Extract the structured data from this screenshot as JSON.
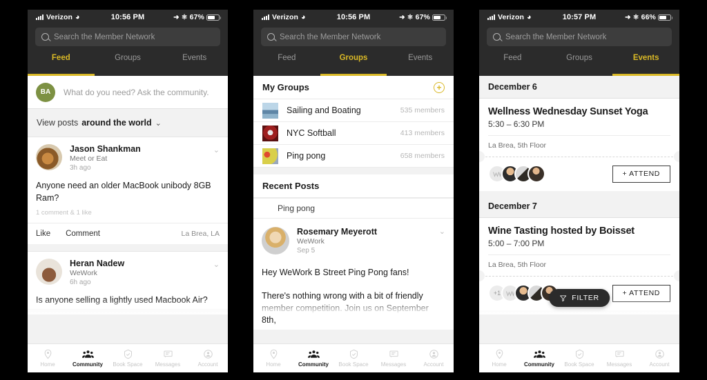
{
  "accent": "#d9b826",
  "panels": [
    {
      "id": "feed",
      "statusbar": {
        "carrier": "Verizon",
        "time": "10:56 PM",
        "battery": "67%"
      },
      "search": {
        "placeholder": "Search the Member Network"
      },
      "tabs": [
        {
          "label": "Feed",
          "active": true
        },
        {
          "label": "Groups",
          "active": false
        },
        {
          "label": "Events",
          "active": false
        }
      ],
      "composer": {
        "initials": "BA",
        "placeholder": "What do you need? Ask the community."
      },
      "filter_row": {
        "prefix": "View posts",
        "value": "around the world",
        "chevron": "∨"
      },
      "posts": [
        {
          "name": "Jason Shankman",
          "org": "Meet or Eat",
          "time": "3h ago",
          "text": "Anyone need an older MacBook unibody 8GB Ram?",
          "meta": "1 comment & 1 like",
          "like_label": "Like",
          "comment_label": "Comment",
          "location": "La Brea, LA"
        },
        {
          "name": "Heran Nadew",
          "org": "WeWork",
          "time": "6h ago",
          "text": "Is anyone selling a lightly used Macbook Air?"
        }
      ]
    },
    {
      "id": "groups",
      "statusbar": {
        "carrier": "Verizon",
        "time": "10:56 PM",
        "battery": "67%"
      },
      "search": {
        "placeholder": "Search the Member Network"
      },
      "tabs": [
        {
          "label": "Feed",
          "active": false
        },
        {
          "label": "Groups",
          "active": true
        },
        {
          "label": "Events",
          "active": false
        }
      ],
      "my_groups": {
        "title": "My Groups",
        "add_label": "+",
        "items": [
          {
            "name": "Sailing and Boating",
            "members": "535 members"
          },
          {
            "name": "NYC Softball",
            "members": "413 members"
          },
          {
            "name": "Ping pong",
            "members": "658 members"
          }
        ]
      },
      "recent_posts": {
        "title": "Recent Posts",
        "group_tag": "Ping pong",
        "post": {
          "name": "Rosemary Meyerott",
          "org": "WeWork",
          "time": "Sep 5",
          "line1": "Hey WeWork B Street Ping Pong fans!",
          "line2": "There's nothing wrong with a bit of friendly member competition. Join us on September 8th,"
        }
      }
    },
    {
      "id": "events",
      "statusbar": {
        "carrier": "Verizon",
        "time": "10:57 PM",
        "battery": "66%"
      },
      "search": {
        "placeholder": "Search the Member Network"
      },
      "tabs": [
        {
          "label": "Feed",
          "active": false
        },
        {
          "label": "Groups",
          "active": false
        },
        {
          "label": "Events",
          "active": true
        }
      ],
      "filter_button": {
        "label": "FILTER"
      },
      "days": [
        {
          "date": "December 6",
          "event": {
            "title": "Wellness Wednesday Sunset Yoga",
            "time": "5:30 – 6:30 PM",
            "location": "La Brea, 5th Floor",
            "attend_label": "+ ATTEND",
            "overflow": ""
          }
        },
        {
          "date": "December 7",
          "event": {
            "title": "Wine Tasting hosted by Boisset",
            "time": "5:00 – 7:00 PM",
            "location": "La Brea, 5th Floor",
            "attend_label": "+ ATTEND",
            "overflow": "+1"
          }
        }
      ]
    }
  ],
  "tabbar": [
    {
      "label": "Home",
      "icon": "pin-icon",
      "active": false
    },
    {
      "label": "Community",
      "icon": "people-icon",
      "active": true
    },
    {
      "label": "Book Space",
      "icon": "shield-check-icon",
      "active": false
    },
    {
      "label": "Messages",
      "icon": "message-icon",
      "active": false
    },
    {
      "label": "Account",
      "icon": "person-icon",
      "active": false
    }
  ]
}
